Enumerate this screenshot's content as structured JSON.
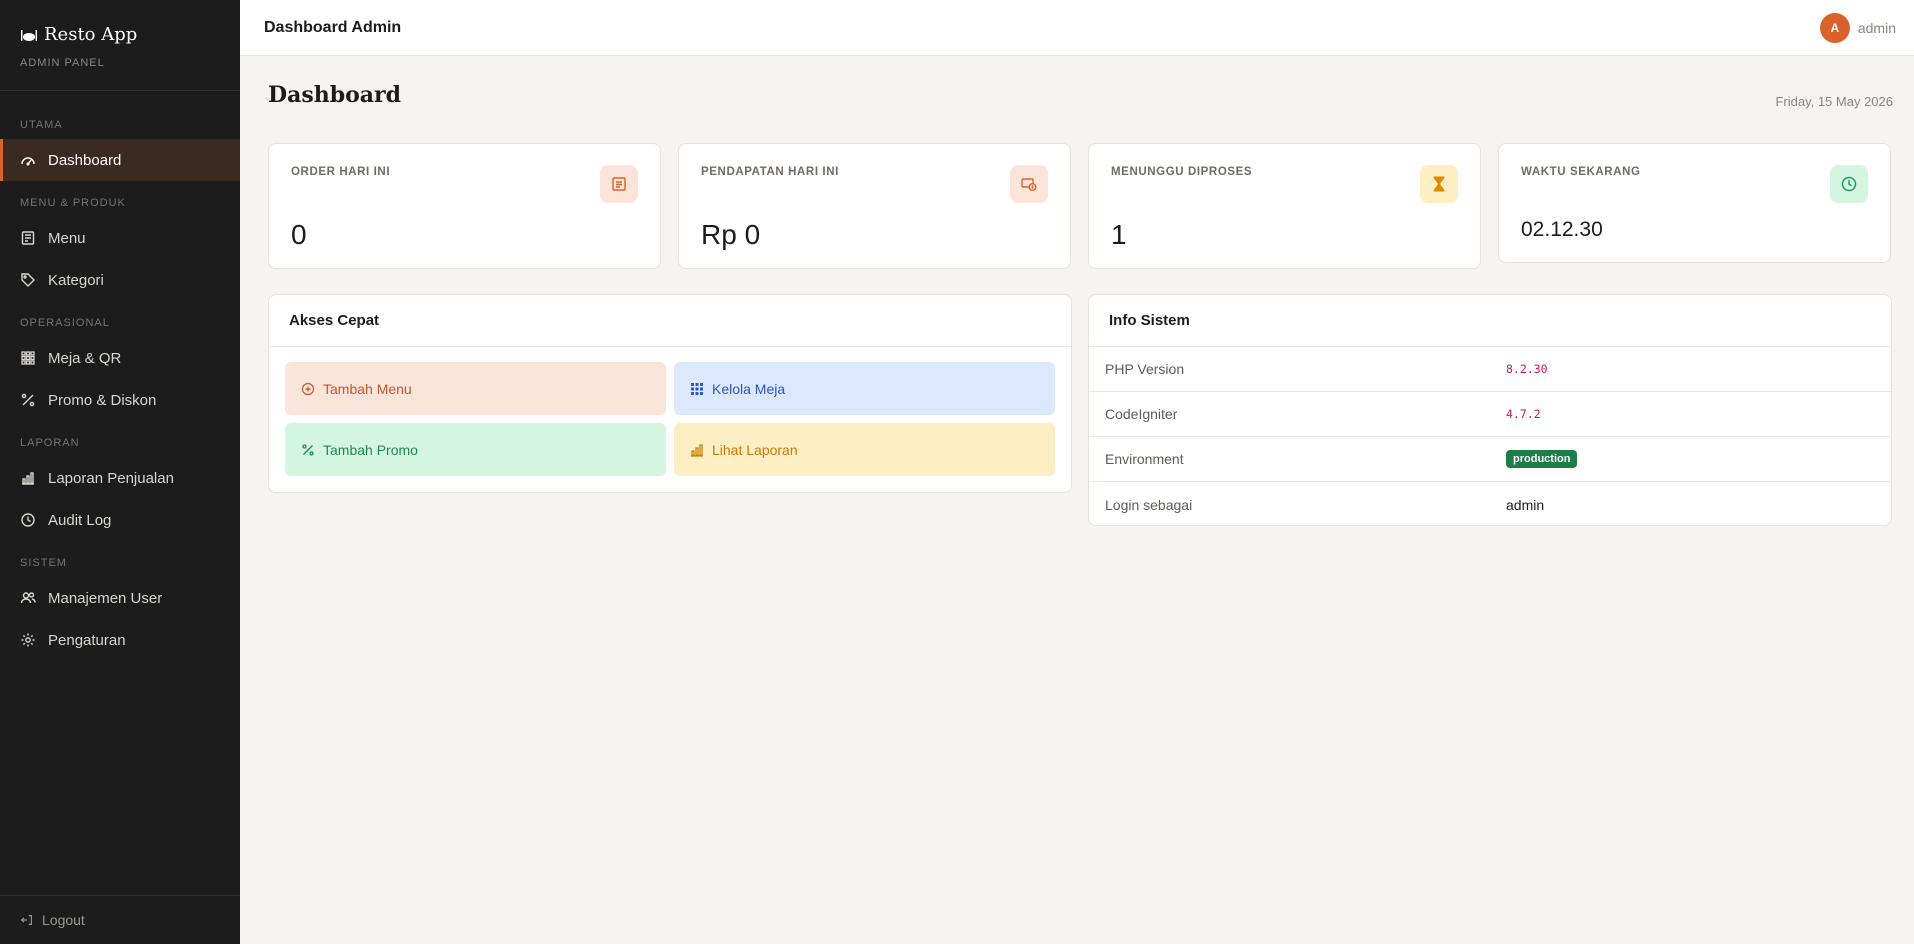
{
  "brand": {
    "title": "Resto App",
    "subtitle": "ADMIN PANEL",
    "icon": "plate-utensils-icon"
  },
  "sidebar": {
    "sections": [
      {
        "label": "UTAMA",
        "items": [
          {
            "label": "Dashboard",
            "icon": "gauge-icon",
            "active": true
          }
        ]
      },
      {
        "label": "MENU & PRODUK",
        "items": [
          {
            "label": "Menu",
            "icon": "book-icon"
          },
          {
            "label": "Kategori",
            "icon": "tag-icon"
          }
        ]
      },
      {
        "label": "OPERASIONAL",
        "items": [
          {
            "label": "Meja & QR",
            "icon": "grid-icon"
          },
          {
            "label": "Promo & Diskon",
            "icon": "percent-icon"
          }
        ]
      },
      {
        "label": "LAPORAN",
        "items": [
          {
            "label": "Laporan Penjualan",
            "icon": "bar-chart-icon"
          },
          {
            "label": "Audit Log",
            "icon": "clock-icon"
          }
        ]
      },
      {
        "label": "SISTEM",
        "items": [
          {
            "label": "Manajemen User",
            "icon": "users-icon"
          },
          {
            "label": "Pengaturan",
            "icon": "gear-icon"
          }
        ]
      }
    ],
    "logout": "Logout"
  },
  "topbar": {
    "title": "Dashboard Admin",
    "user_initial": "A",
    "user_name": "admin"
  },
  "page": {
    "title": "Dashboard",
    "date": "Friday, 15 May 2026"
  },
  "stats": [
    {
      "label": "ORDER HARI INI",
      "value": "0",
      "icon": "receipt-icon",
      "accent": "#d9622b",
      "bg": "#fbe4da"
    },
    {
      "label": "PENDAPATAN HARI INI",
      "value": "Rp 0",
      "icon": "cash-icon",
      "accent": "#d9622b",
      "bg": "#fbe4da"
    },
    {
      "label": "MENUNGGU DIPROSES",
      "value": "1",
      "icon": "hourglass-icon",
      "accent": "#e08a00",
      "bg": "#fdefc3"
    },
    {
      "label": "WAKTU SEKARANG",
      "value": "02.12.30",
      "icon": "clock-icon",
      "accent": "#1f9b5c",
      "bg": "#d5f5e3"
    }
  ],
  "quick_access": {
    "title": "Akses Cepat",
    "items": [
      {
        "label": "Tambah Menu",
        "icon": "plus-circle-icon",
        "color": "#c5572a",
        "bg": "#fbe4da"
      },
      {
        "label": "Kelola Meja",
        "icon": "grid-icon",
        "color": "#2f55c8",
        "bg": "#dbe8fd"
      },
      {
        "label": "Tambah Promo",
        "icon": "percent-icon",
        "color": "#1e8a50",
        "bg": "#d5f5e3"
      },
      {
        "label": "Lihat Laporan",
        "icon": "bar-chart-icon",
        "color": "#c77b00",
        "bg": "#fdefc3"
      }
    ]
  },
  "system_info": {
    "title": "Info Sistem",
    "rows": [
      {
        "key": "PHP Version",
        "value": "8.2.30",
        "style": "mono"
      },
      {
        "key": "CodeIgniter",
        "value": "4.7.2",
        "style": "mono"
      },
      {
        "key": "Environment",
        "value": "production",
        "style": "badge"
      },
      {
        "key": "Login sebagai",
        "value": "admin",
        "style": "plain"
      }
    ]
  }
}
